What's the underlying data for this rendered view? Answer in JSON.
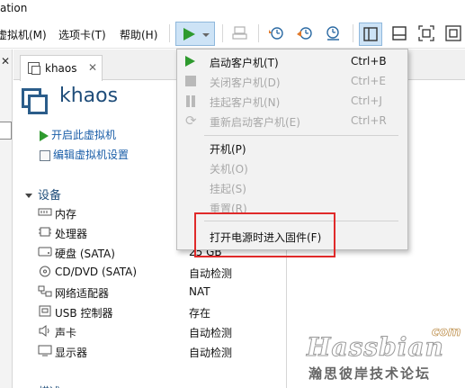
{
  "window": {
    "title_fragment": "ation"
  },
  "menubar": {
    "items": [
      "虚拟机(M)",
      "选项卡(T)",
      "帮助(H)"
    ]
  },
  "tab": {
    "label": "khaos"
  },
  "vm": {
    "title": "khaos",
    "actions": [
      "开启此虚拟机",
      "编辑虚拟机设置"
    ]
  },
  "devices": {
    "header": "设备",
    "rows": [
      {
        "icon": "memory-icon",
        "name": "内存",
        "value": ""
      },
      {
        "icon": "processor-icon",
        "name": "处理器",
        "value": ""
      },
      {
        "icon": "hard-disk-icon",
        "name": "硬盘 (SATA)",
        "value": "25 GB"
      },
      {
        "icon": "cd-dvd-icon",
        "name": "CD/DVD (SATA)",
        "value": "自动检测"
      },
      {
        "icon": "network-adapter-icon",
        "name": "网络适配器",
        "value": "NAT"
      },
      {
        "icon": "usb-icon",
        "name": "USB 控制器",
        "value": "存在"
      },
      {
        "icon": "sound-card-icon",
        "name": "声卡",
        "value": "自动检测"
      },
      {
        "icon": "display-icon",
        "name": "显示器",
        "value": "自动检测"
      }
    ],
    "next_section": "描述"
  },
  "power_menu": {
    "items": [
      {
        "label": "启动客户机(T)",
        "shortcut": "Ctrl+B",
        "enabled": true,
        "icon": "play-icon"
      },
      {
        "label": "关闭客户机(D)",
        "shortcut": "Ctrl+E",
        "enabled": false,
        "icon": "stop-icon"
      },
      {
        "label": "挂起客户机(N)",
        "shortcut": "Ctrl+J",
        "enabled": false,
        "icon": "pause-icon"
      },
      {
        "label": "重新启动客户机(E)",
        "shortcut": "Ctrl+R",
        "enabled": false,
        "icon": "restart-icon"
      },
      {
        "label": "开机(P)",
        "shortcut": "",
        "enabled": true
      },
      {
        "label": "关机(O)",
        "shortcut": "",
        "enabled": false
      },
      {
        "label": "挂起(S)",
        "shortcut": "",
        "enabled": false
      },
      {
        "label": "重置(R)",
        "shortcut": "",
        "enabled": false
      },
      {
        "label": "打开电源时进入固件(F)",
        "shortcut": "",
        "enabled": true
      }
    ]
  },
  "colors": {
    "accent": "#2e9a2e",
    "link": "#1a5ea8",
    "highlight_box": "#e02a2a",
    "menu_bg": "#f2f2f2"
  },
  "watermark": {
    "brand": "Hassbian",
    "domain": "com",
    "subtitle": "瀚思彼岸技术论坛"
  }
}
